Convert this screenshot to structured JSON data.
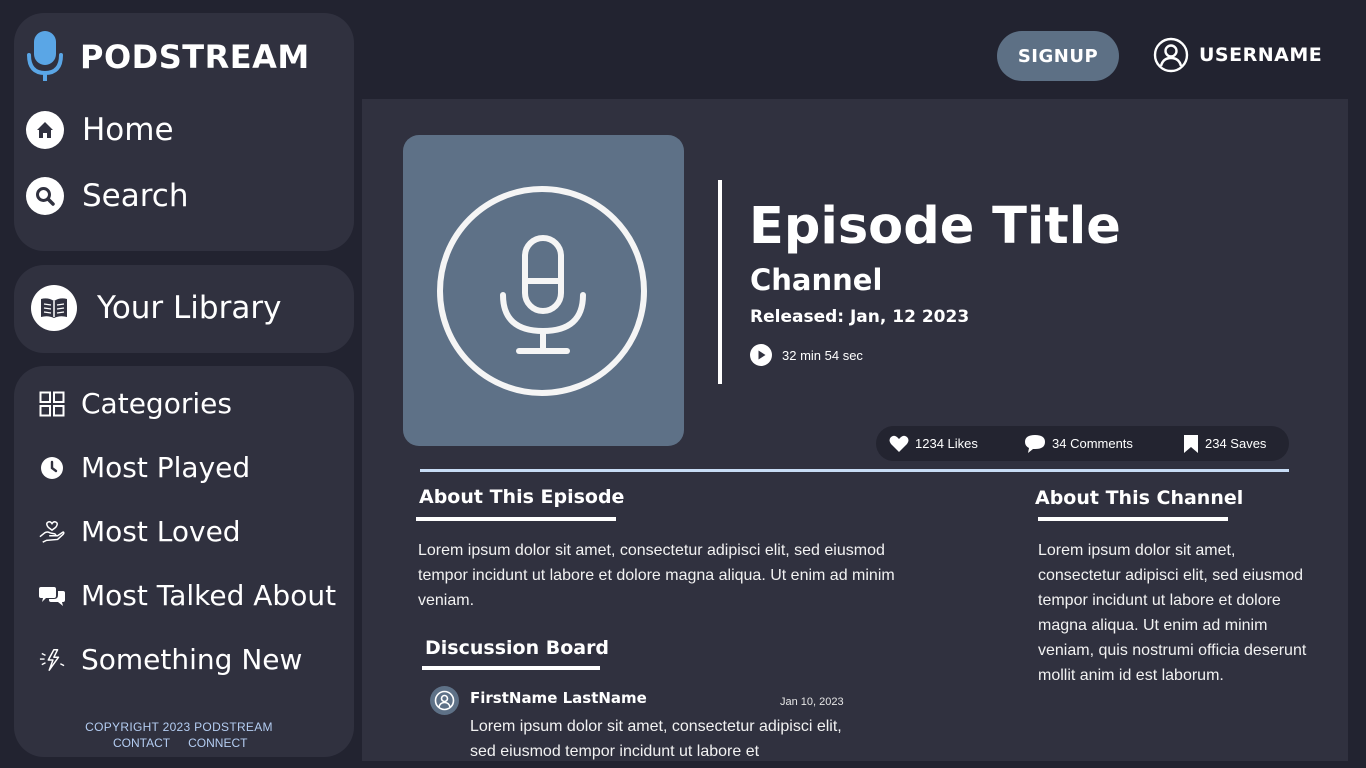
{
  "brand": {
    "name": "PODSTREAM",
    "icon": "microphone-icon"
  },
  "nav": {
    "home_label": "Home",
    "search_label": "Search",
    "library_label": "Your Library"
  },
  "categories": {
    "items": [
      {
        "label": "Categories",
        "icon": "grid-icon"
      },
      {
        "label": "Most Played",
        "icon": "clock-icon"
      },
      {
        "label": "Most Loved",
        "icon": "heart-hand-icon"
      },
      {
        "label": "Most Talked About",
        "icon": "chat-bubbles-icon"
      },
      {
        "label": "Something New",
        "icon": "sparkle-bolt-icon"
      }
    ]
  },
  "footer": {
    "copyright": "COPYRIGHT 2023 PODSTREAM",
    "contact": "CONTACT",
    "connect": "CONNECT"
  },
  "header": {
    "signup_label": "SIGNUP",
    "username": "USERNAME"
  },
  "episode": {
    "title": "Episode Title",
    "channel": "Channel",
    "released": "Released: Jan, 12 2023",
    "duration": "32 min 54 sec"
  },
  "stats": {
    "likes": "1234 Likes",
    "comments": "34  Comments",
    "saves": "234 Saves"
  },
  "about_episode": {
    "heading": "About This Episode",
    "text": "Lorem ipsum dolor sit amet, consectetur adipisci elit, sed eiusmod tempor incidunt ut labore et dolore magna aliqua. Ut enim ad minim veniam."
  },
  "about_channel": {
    "heading": "About This Channel",
    "text": "Lorem ipsum dolor sit amet, consectetur adipisci elit, sed eiusmod tempor incidunt ut labore et dolore magna aliqua. Ut enim ad minim veniam, quis nostrumi officia deserunt mollit anim id est laborum."
  },
  "discussion": {
    "heading": "Discussion Board",
    "comments": [
      {
        "name": "FirstName LastName",
        "date": "Jan 10, 2023",
        "text": "Lorem ipsum dolor sit amet, consectetur adipisci elit, sed eiusmod tempor incidunt ut labore et"
      }
    ]
  },
  "colors": {
    "background": "#222330",
    "panel": "#30313f",
    "accent_blue": "#5e7187",
    "mic_blue": "#5aa6e6",
    "divider_light": "#c7dcf5",
    "footer_text": "#b4cdf2"
  }
}
